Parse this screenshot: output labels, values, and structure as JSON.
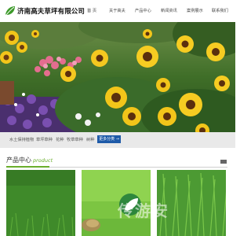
{
  "header": {
    "brand": "济南高夫草坪有限公司",
    "logo_icon": "leaf-logo-icon",
    "brand_color": "#3d9a2a"
  },
  "nav": {
    "items": [
      {
        "label": "首 页"
      },
      {
        "label": "关于高夫"
      },
      {
        "label": "产品中心"
      },
      {
        "label": "新闻资讯"
      },
      {
        "label": "案例展示"
      },
      {
        "label": "联系我们"
      }
    ]
  },
  "hero": {
    "image": "sunflower-garden-banner"
  },
  "tags": {
    "items": [
      "水土保持植物",
      "草坪草种",
      "花种",
      "牧草草种",
      "树种"
    ],
    "more_label": "更多分类 →",
    "more_color": "#1e5aa8"
  },
  "products": {
    "title": "产品中心",
    "title_en": "product",
    "accent": "#6aae2c",
    "watermark": "传游安"
  }
}
